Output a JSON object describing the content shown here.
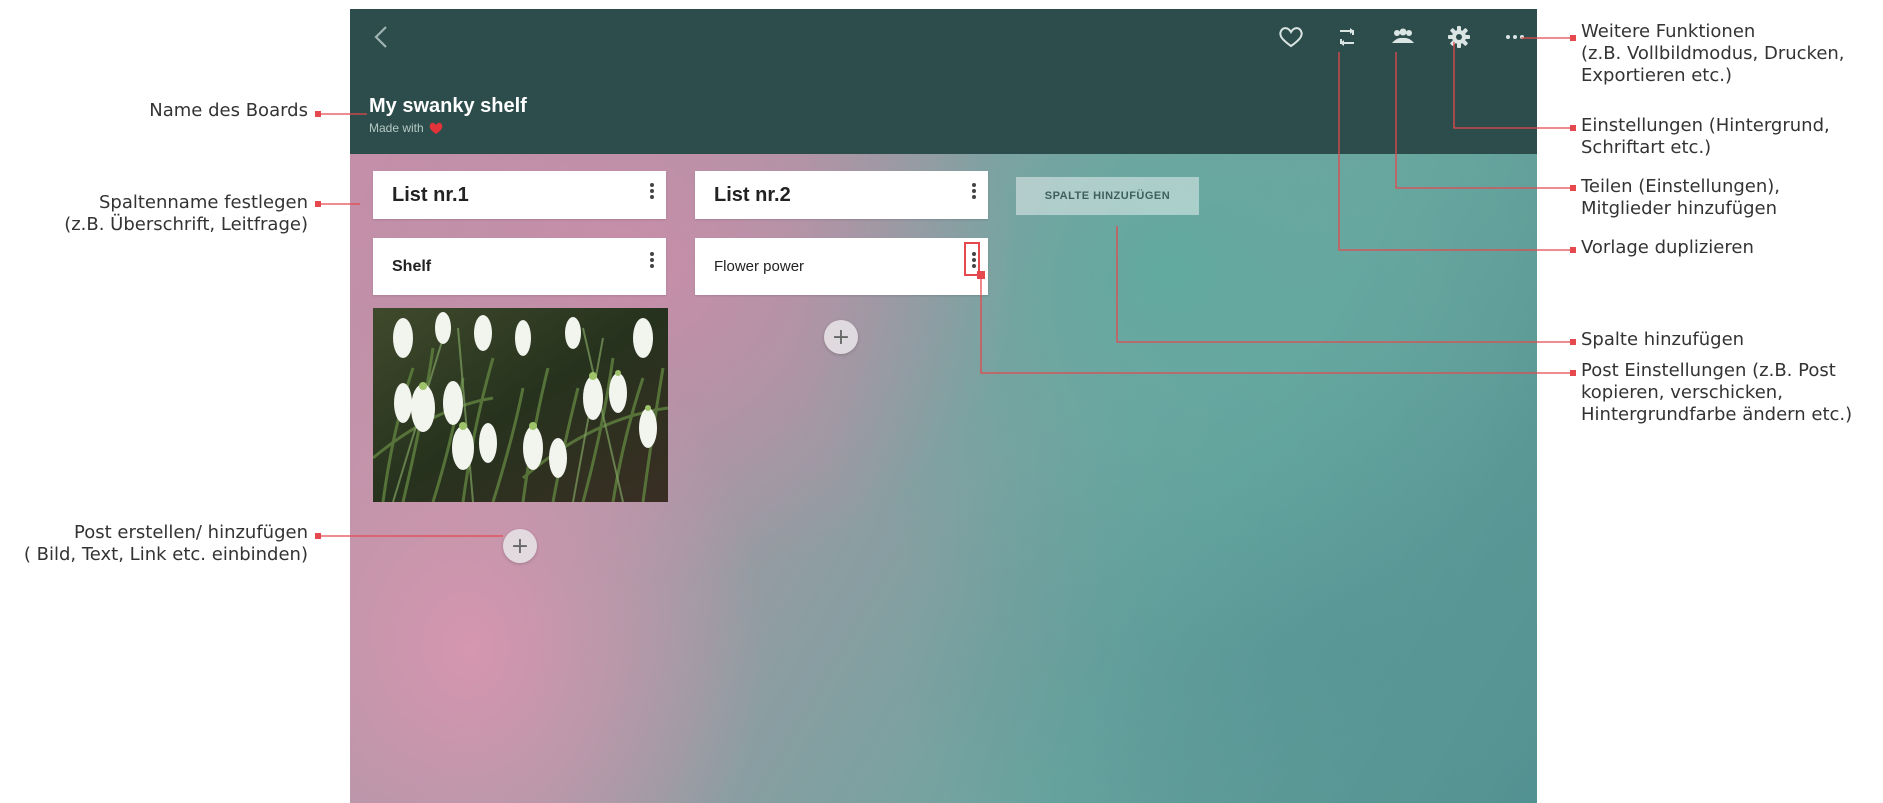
{
  "board": {
    "title": "My swanky shelf",
    "subtitle": "Made with"
  },
  "columns": [
    {
      "name": "List nr.1",
      "posts": [
        {
          "title": "Shelf"
        }
      ]
    },
    {
      "name": "List nr.2",
      "posts": [
        {
          "title": "Flower power"
        }
      ]
    }
  ],
  "add_column_label": "SPALTE HINZUFÜGEN",
  "plus_glyph": "+",
  "toolbar_icons": [
    "back-icon",
    "heart-icon",
    "remix-icon",
    "members-icon",
    "gear-icon",
    "more-icon"
  ],
  "annotations": {
    "board_name": "Name des Boards",
    "column_name": [
      "Spaltenname festlegen",
      "(z.B. Überschrift, Leitfrage)"
    ],
    "post_create": [
      "Post erstellen/ hinzufügen",
      "( Bild, Text, Link etc. einbinden)"
    ],
    "more_functions": [
      "Weitere Funktionen",
      "(z.B. Vollbildmodus, Drucken,",
      "Exportieren etc.)"
    ],
    "settings": [
      "Einstellungen (Hintergrund,",
      "Schriftart etc.)"
    ],
    "share": [
      "Teilen (Einstellungen),",
      "Mitglieder hinzufügen"
    ],
    "duplicate": "Vorlage duplizieren",
    "add_column": "Spalte hinzufügen",
    "post_settings": [
      "Post Einstellungen (z.B. Post",
      "kopieren, verschicken,",
      "Hintergrundfarbe ändern etc.)"
    ]
  },
  "colors": {
    "topbar": "#2c4d4b",
    "callout_line": "#e5484d"
  }
}
